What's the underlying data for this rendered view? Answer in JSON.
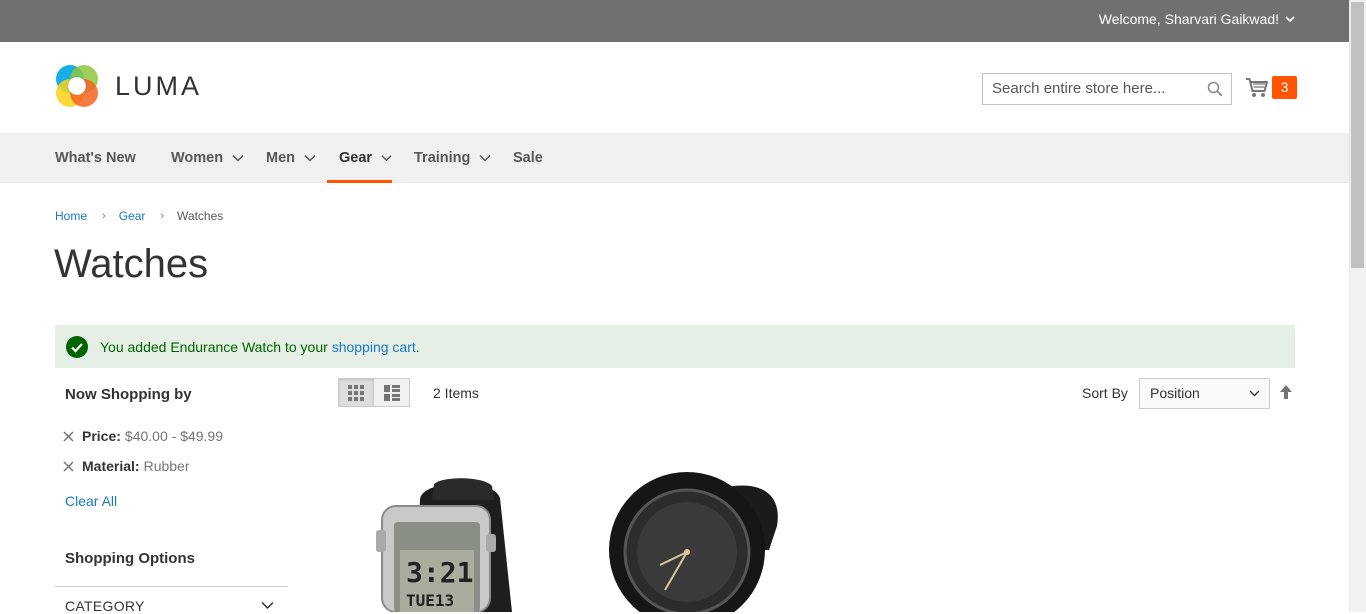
{
  "topbar": {
    "welcome": "Welcome, Sharvari Gaikwad!"
  },
  "header": {
    "logo_text": "LUMA",
    "search_placeholder": "Search entire store here...",
    "cart_count": "3"
  },
  "nav": [
    {
      "label": "What's New",
      "dropdown": false
    },
    {
      "label": "Women",
      "dropdown": true
    },
    {
      "label": "Men",
      "dropdown": true
    },
    {
      "label": "Gear",
      "dropdown": true,
      "active": true
    },
    {
      "label": "Training",
      "dropdown": true
    },
    {
      "label": "Sale",
      "dropdown": false
    }
  ],
  "breadcrumb": {
    "home": "Home",
    "gear": "Gear",
    "current": "Watches"
  },
  "page_title": "Watches",
  "message": {
    "text_before": "You added Endurance Watch to your ",
    "link": "shopping cart",
    "text_after": "."
  },
  "sidebar": {
    "now_shopping_title": "Now Shopping by",
    "filters": [
      {
        "label": "Price:",
        "value": "$40.00 - $49.99"
      },
      {
        "label": "Material:",
        "value": "Rubber"
      }
    ],
    "clear_all": "Clear All",
    "shopping_options_title": "Shopping Options",
    "category_label": "CATEGORY"
  },
  "toolbar": {
    "items_count": "2 Items",
    "sort_label": "Sort By",
    "sort_value": "Position"
  },
  "colors": {
    "accent": "#ff5501",
    "link": "#1979c3",
    "success": "#006400"
  },
  "products": [
    {
      "image": "digital-watch-image"
    },
    {
      "image": "analog-watch-image"
    }
  ]
}
